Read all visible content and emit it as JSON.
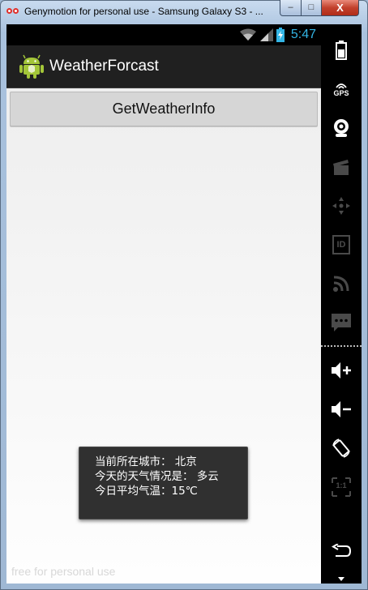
{
  "window": {
    "title": "Genymotion for personal use - Samsung Galaxy S3 - ...",
    "min_label": "–",
    "max_label": "□",
    "close_label": "X"
  },
  "statusbar": {
    "time": "5:47"
  },
  "app": {
    "title": "WeatherForcast"
  },
  "main": {
    "button_label": "GetWeatherInfo"
  },
  "toast": {
    "lines": [
      "当前所在城市： 北京",
      "今天的天气情况是： 多云",
      "今日平均气温：15℃"
    ]
  },
  "watermark": "free for personal use",
  "toolbar": {
    "items": [
      {
        "icon": "battery-icon",
        "enabled": true
      },
      {
        "icon": "gps-icon",
        "label": "GPS",
        "enabled": true
      },
      {
        "icon": "webcam-icon",
        "enabled": true
      },
      {
        "icon": "clapperboard-icon",
        "enabled": false
      },
      {
        "icon": "dpad-icon",
        "enabled": false
      },
      {
        "icon": "id-icon",
        "label": "ID",
        "enabled": false
      },
      {
        "icon": "rss-icon",
        "enabled": false
      },
      {
        "icon": "sms-icon",
        "enabled": false
      },
      {
        "icon": "volume-up-icon",
        "enabled": true
      },
      {
        "icon": "volume-down-icon",
        "enabled": true
      },
      {
        "icon": "rotate-icon",
        "enabled": true
      },
      {
        "icon": "scale-icon",
        "label": "1:1",
        "enabled": false
      },
      {
        "icon": "back-icon",
        "enabled": true
      }
    ]
  },
  "colors": {
    "status_time": "#33b5e5",
    "toolbar_enabled": "#ffffff",
    "toolbar_disabled": "#4a4a4a"
  }
}
